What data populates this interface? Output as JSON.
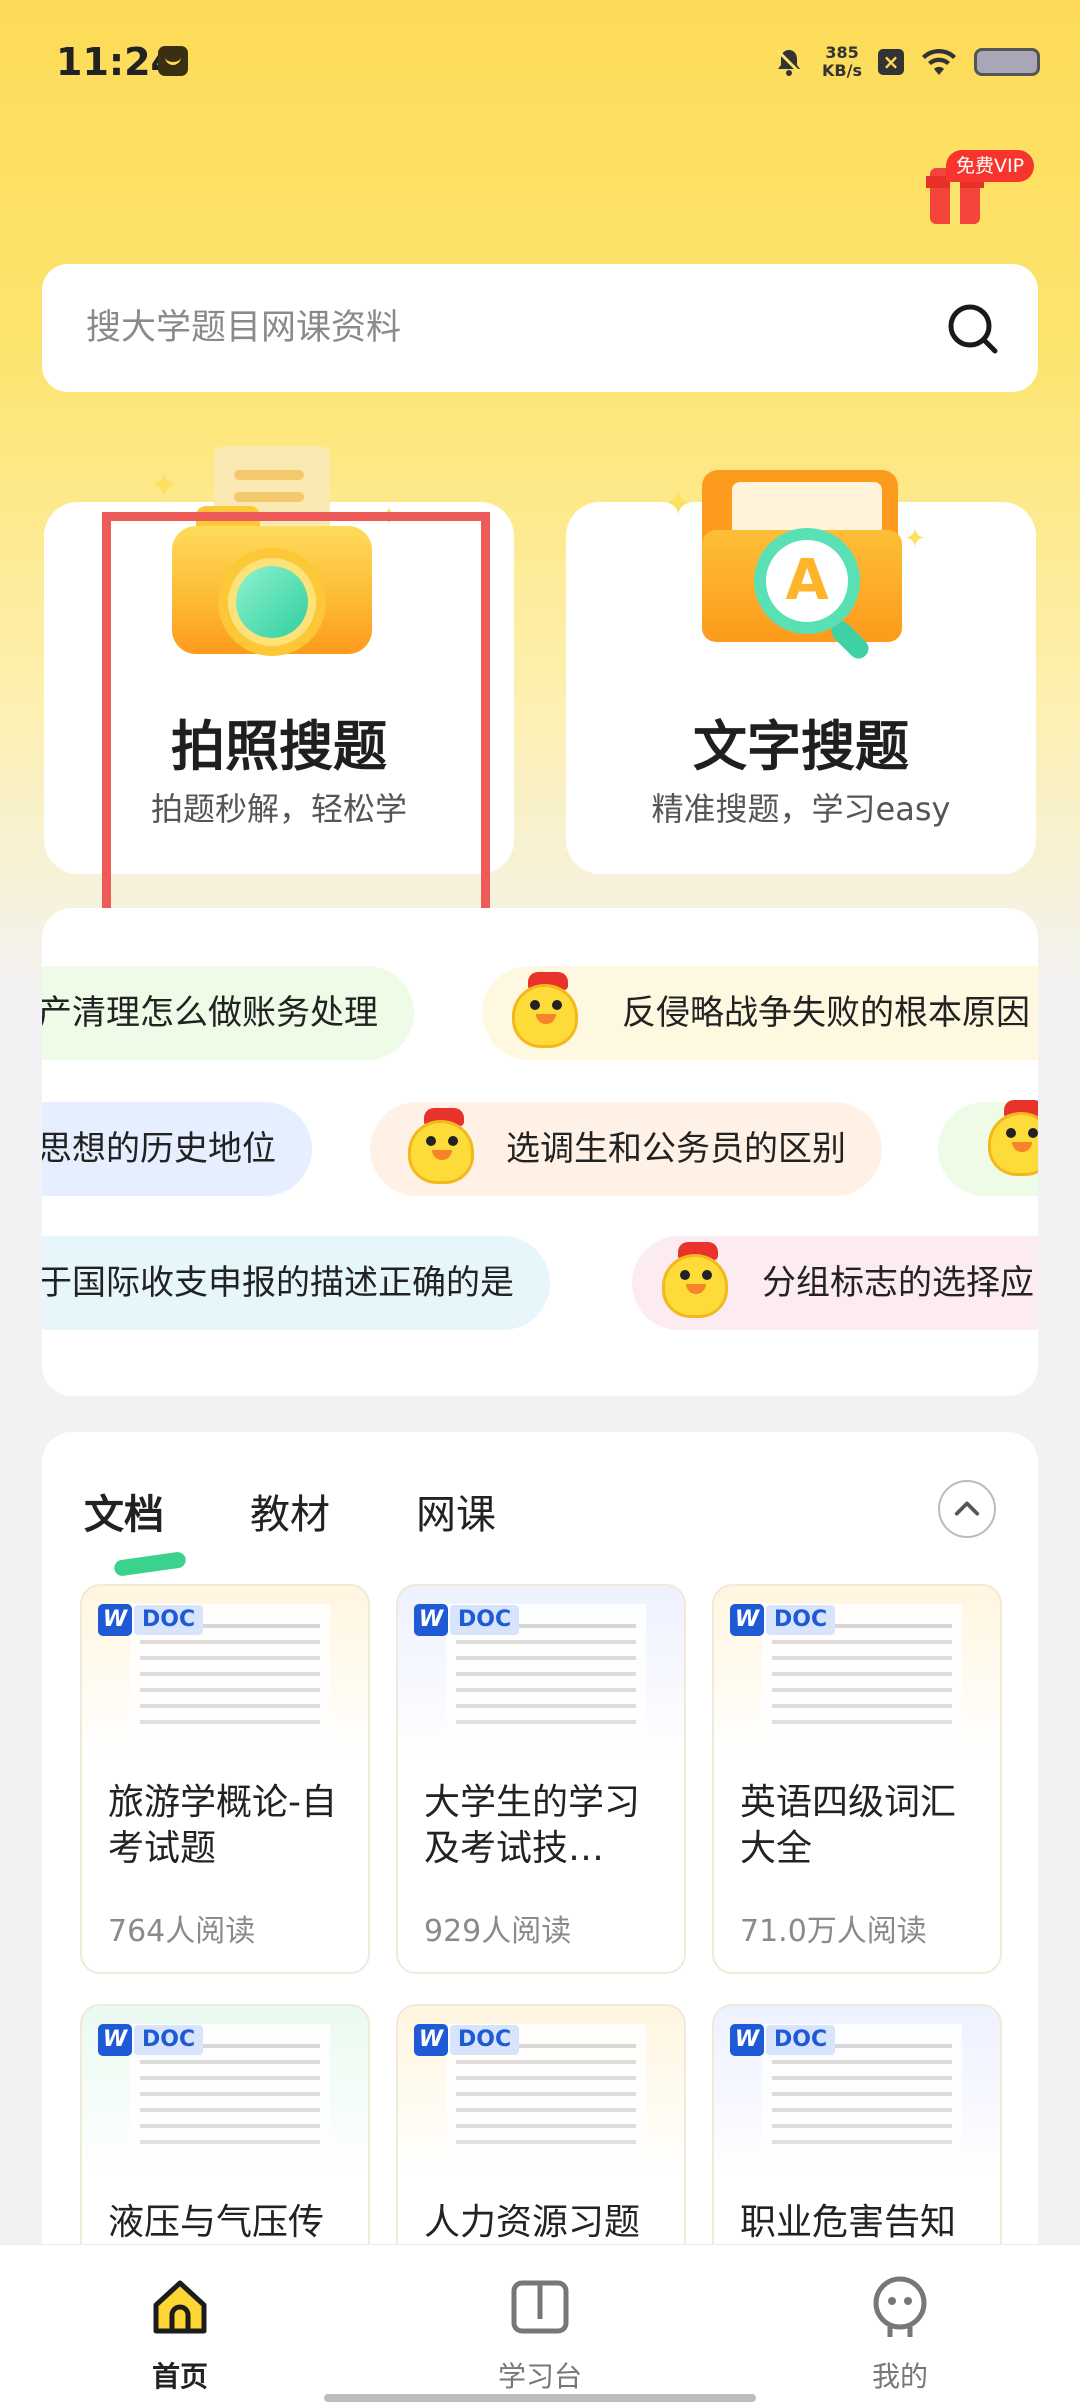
{
  "status_bar": {
    "time": "11:24",
    "speed_value": "385",
    "speed_unit": "KB/s"
  },
  "vip": {
    "label": "免费VIP"
  },
  "search": {
    "placeholder": "搜大学题目网课资料"
  },
  "cards": [
    {
      "title": "拍照搜题",
      "subtitle": "拍题秒解，轻松学"
    },
    {
      "title": "文字搜题",
      "subtitle": "精准搜题，学习easy"
    }
  ],
  "topics": {
    "rows": [
      [
        "产清理怎么做账务处理",
        "反侵略战争失败的根本原因"
      ],
      [
        "思想的历史地位",
        "选调生和公务员的区别",
        ""
      ],
      [
        "于国际收支申报的描述正确的是",
        "分组标志的选择应"
      ]
    ]
  },
  "docs": {
    "tabs": [
      "文档",
      "教材",
      "网课"
    ],
    "badge_letter": "W",
    "badge_text": "DOC",
    "items": [
      {
        "title": "旅游学概论-自考试题",
        "reads": "764人阅读",
        "tint": "#fff6e0"
      },
      {
        "title": "大学生的学习及考试技…",
        "reads": "929人阅读",
        "tint": "#eef1ff"
      },
      {
        "title": "英语四级词汇大全",
        "reads": "71.0万人阅读",
        "tint": "#fff6e0"
      },
      {
        "title": "液压与气压传",
        "reads": "",
        "tint": "#eafaf0"
      },
      {
        "title": "人力资源习题",
        "reads": "",
        "tint": "#fff6e0"
      },
      {
        "title": "职业危害告知",
        "reads": "",
        "tint": "#eef1ff"
      }
    ]
  },
  "tabbar": {
    "items": [
      "首页",
      "学习台",
      "我的"
    ]
  },
  "colors": {
    "brand_yellow": "#fddb58",
    "highlight_red": "#ec5b58",
    "accent_green": "#3ad28d",
    "doc_blue": "#1f5ad6"
  }
}
